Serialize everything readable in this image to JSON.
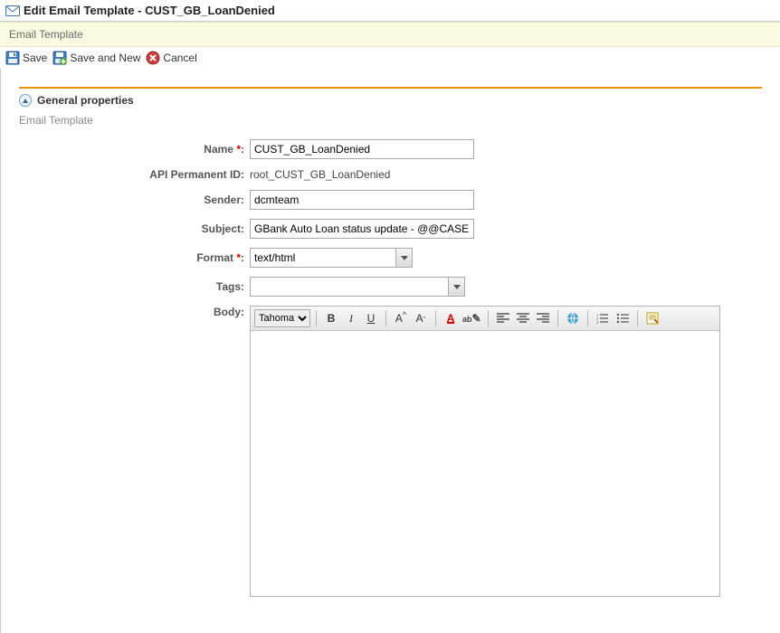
{
  "header": {
    "title": "Edit Email Template - CUST_GB_LoanDenied"
  },
  "breadcrumb": "Email Template",
  "toolbar": {
    "save_label": "Save",
    "save_new_label": "Save and New",
    "cancel_label": "Cancel"
  },
  "section": {
    "title": "General properties",
    "sub_label": "Email Template"
  },
  "form": {
    "name_label": "Name",
    "name_value": "CUST_GB_LoanDenied",
    "api_label": "API Permanent ID:",
    "api_value": "root_CUST_GB_LoanDenied",
    "sender_label": "Sender:",
    "sender_value": "dcmteam",
    "subject_label": "Subject:",
    "subject_value": "GBank Auto Loan status update - @@CASEID",
    "format_label": "Format",
    "format_value": "text/html",
    "tags_label": "Tags:",
    "tags_value": "",
    "body_label": "Body:"
  },
  "editor": {
    "font_family": "Tahoma",
    "body_value": ""
  }
}
